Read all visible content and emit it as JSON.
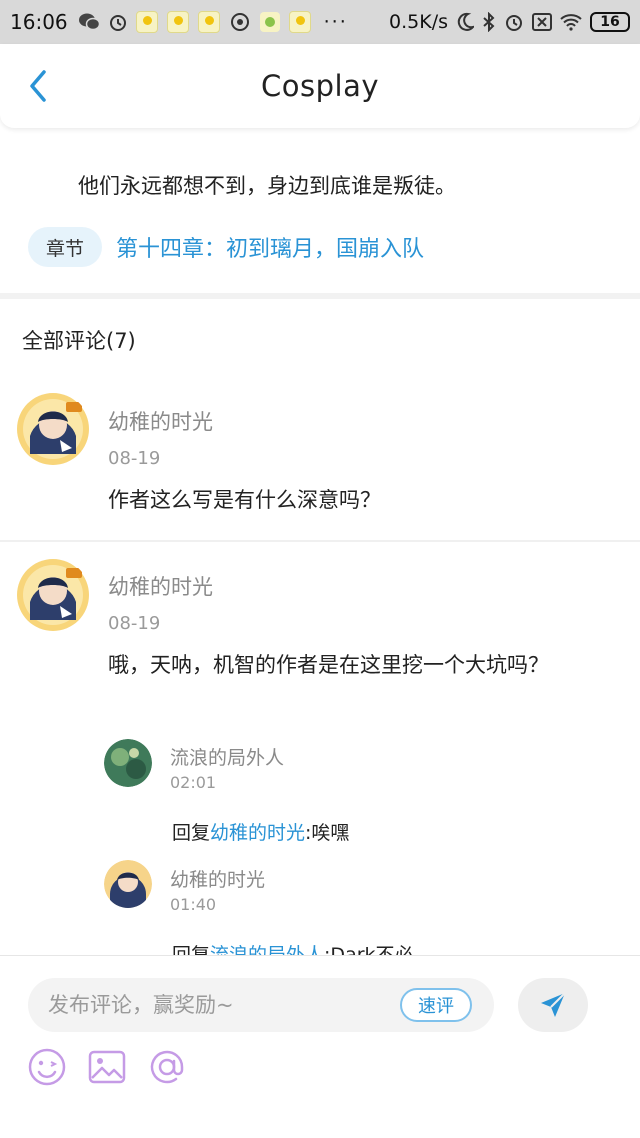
{
  "status_bar": {
    "time": "16:06",
    "network_speed": "0.5K/s",
    "battery": "16",
    "more": "···"
  },
  "header": {
    "title": "Cosplay"
  },
  "chapter": {
    "quote": "他们永远都想不到，身边到底谁是叛徒。",
    "tag_label": "章节",
    "link_text": "第十四章：初到璃月，国崩入队"
  },
  "comments_section": {
    "title": "全部评论(7)"
  },
  "comments": [
    {
      "author": "幼稚的时光",
      "date": "08-19",
      "text": "作者这么写是有什么深意吗？"
    },
    {
      "author": "幼稚的时光",
      "date": "08-19",
      "text": "哦，天呐，机智的作者是在这里挖一个大坑吗？",
      "replies": [
        {
          "author": "流浪的局外人",
          "time": "02:01",
          "prefix": "回复",
          "reply_to": "幼稚的时光",
          "text": ":唉嘿"
        },
        {
          "author": "幼稚的时光",
          "time": "01:40",
          "prefix": "回复",
          "reply_to": "流浪的局外人",
          "text": ":Dark不必"
        }
      ]
    }
  ],
  "composer": {
    "placeholder": "发布评论，赢奖励~",
    "quick_review_label": "速评"
  },
  "colors": {
    "accent": "#2a93d5",
    "tag_bg": "#e6f3fb",
    "tool_icon": "#c59be6"
  }
}
